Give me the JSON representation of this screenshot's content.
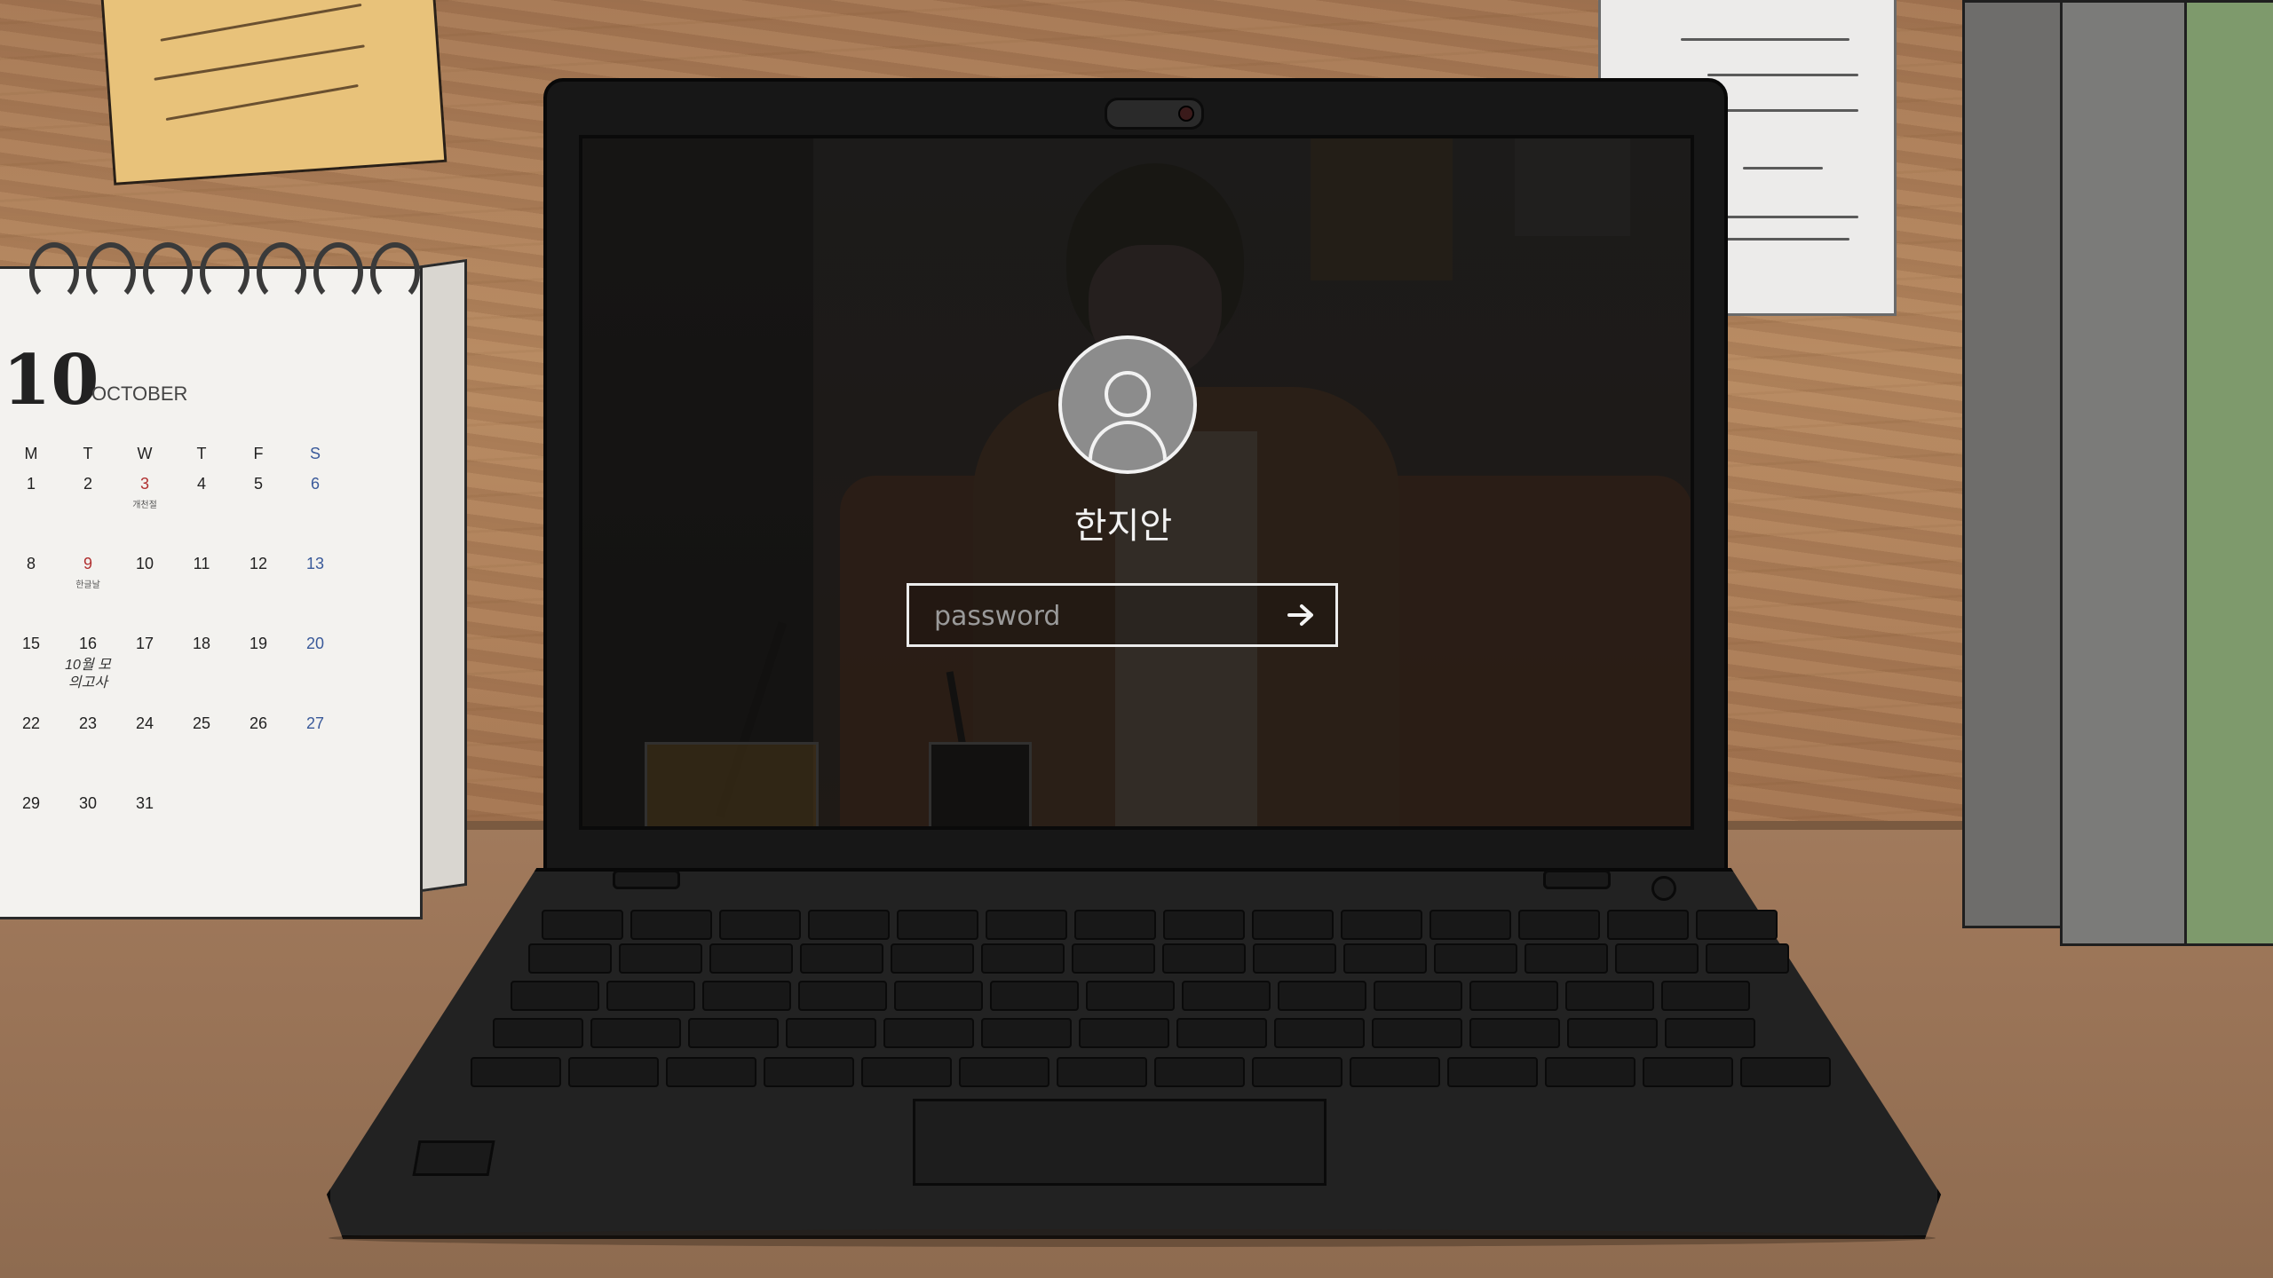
{
  "calendar": {
    "month_number": "10",
    "month_name": "OCTOBER",
    "weekdays": [
      "M",
      "T",
      "W",
      "T",
      "F",
      "S"
    ],
    "weeks": [
      [
        {
          "d": "1"
        },
        {
          "d": "2"
        },
        {
          "d": "3",
          "style": "red",
          "note": "개천절"
        },
        {
          "d": "4"
        },
        {
          "d": "5"
        },
        {
          "d": "6",
          "style": "blue"
        }
      ],
      [
        {
          "d": "8"
        },
        {
          "d": "9",
          "style": "red",
          "note": "한글날"
        },
        {
          "d": "10"
        },
        {
          "d": "11"
        },
        {
          "d": "12"
        },
        {
          "d": "13",
          "style": "blue"
        }
      ],
      [
        {
          "d": "15"
        },
        {
          "d": "16",
          "note_big": "10월 모의고사"
        },
        {
          "d": "17"
        },
        {
          "d": "18"
        },
        {
          "d": "19"
        },
        {
          "d": "20",
          "style": "blue"
        }
      ],
      [
        {
          "d": "22"
        },
        {
          "d": "23"
        },
        {
          "d": "24"
        },
        {
          "d": "25"
        },
        {
          "d": "26"
        },
        {
          "d": "27",
          "style": "blue"
        }
      ],
      [
        {
          "d": "29"
        },
        {
          "d": "30"
        },
        {
          "d": "31"
        },
        {
          "d": ""
        },
        {
          "d": ""
        },
        {
          "d": ""
        }
      ]
    ]
  },
  "login": {
    "username": "한지안",
    "password_placeholder": "password",
    "password_value": "",
    "submit_icon": "arrow-right-icon",
    "avatar_icon": "user-icon"
  },
  "colors": {
    "screen_text": "#f2f2f2",
    "avatar_bg": "#8c8c8c",
    "sunday_blue": "#3a5a9a",
    "holiday_red": "#b03030"
  }
}
